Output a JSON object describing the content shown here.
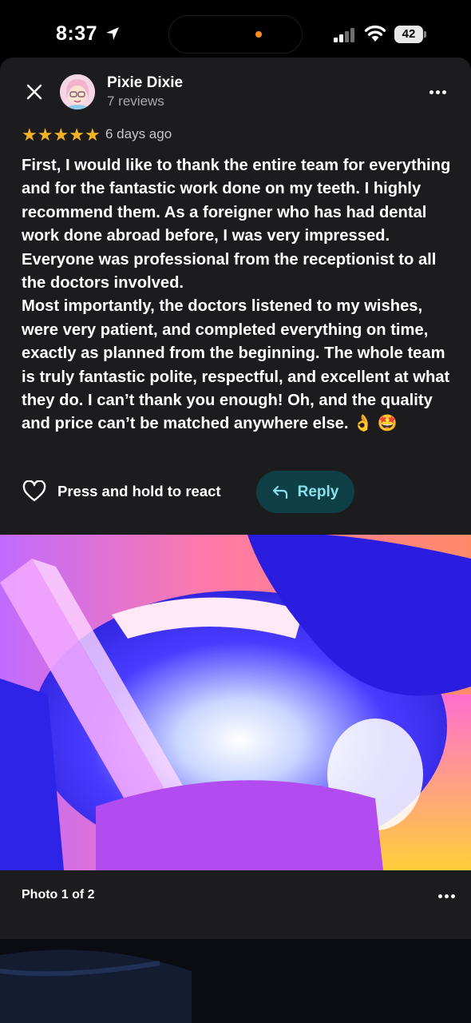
{
  "status_bar": {
    "time": "8:37",
    "battery": "42",
    "icons": [
      "location-arrow-icon",
      "cellular-signal-icon",
      "wifi-icon",
      "battery-icon"
    ],
    "activity_dot_color": "#ff8c1a"
  },
  "review": {
    "reviewer_name": "Pixie Dixie",
    "review_count": "7 reviews",
    "rating": 5,
    "date": "6 days ago",
    "text": "First, I would like to thank the entire team for everything and for the fantastic work done on my teeth. I highly recommend them. As a foreigner who has had dental work done abroad before, I was very impressed. Everyone was professional from the receptionist to all the doctors involved.\nMost importantly, the doctors listened to my wishes, were very patient, and completed everything on time, exactly as planned from the beginning. The whole team is truly fantastic polite, respectful, and excellent at what they do. I can’t thank you enough! Oh, and the quality and price can’t be matched anywhere else. 👌 🤩"
  },
  "actions": {
    "react_label": "Press and hold to react",
    "reply_label": "Reply"
  },
  "photo": {
    "caption": "Photo 1 of 2"
  },
  "colors": {
    "sheet_background": "#1c1c1e",
    "star": "#f5b324",
    "reply_background": "#0f3f46",
    "reply_text": "#8ae0ea"
  }
}
